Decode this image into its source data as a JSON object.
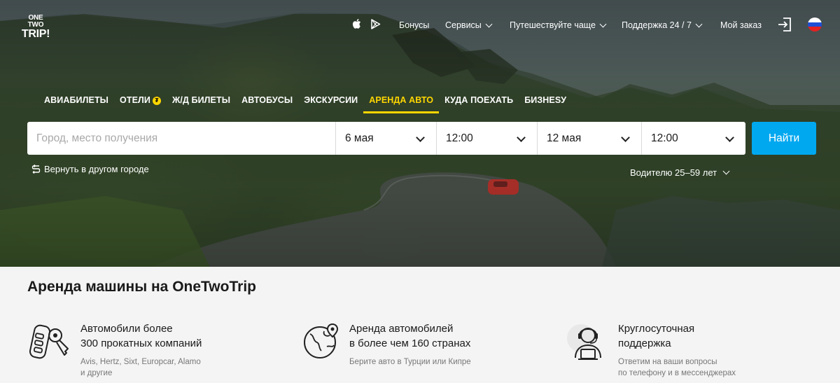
{
  "brand": {
    "logo_line1": "ONE TWO",
    "logo_line2": "TRIP!"
  },
  "topnav": {
    "apple_icon": "apple-icon",
    "play_icon": "google-play-icon",
    "bonuses": "Бонусы",
    "services": "Сервисы",
    "travel_more": "Путешествуйте чаще",
    "support": "Поддержка 24 / 7",
    "my_order": "Мой заказ",
    "login_icon": "login-icon",
    "language_icon": "russian-flag-icon"
  },
  "tabs": [
    {
      "label": "АВИАБИЛЕТЫ"
    },
    {
      "label": "ОТЕЛИ",
      "badge": "₮"
    },
    {
      "label": "Ж/Д БИЛЕТЫ"
    },
    {
      "label": "АВТОБУСЫ"
    },
    {
      "label": "ЭКСКУРСИИ"
    },
    {
      "label": "АРЕНДА АВТО",
      "active": true
    },
    {
      "label": "КУДА ПОЕХАТЬ"
    },
    {
      "label": "БИЗНЕSУ"
    }
  ],
  "search": {
    "place_placeholder": "Город, место получения",
    "pickup_date": "6 мая",
    "pickup_time": "12:00",
    "return_date": "12 мая",
    "return_time": "12:00",
    "submit_label": "Найти"
  },
  "options": {
    "return_other_city": "Вернуть в другом городе",
    "driver_age": "Водителю 25–59 лет"
  },
  "about": {
    "title": "Аренда машины на OneTwoTrip",
    "features": [
      {
        "icon": "car-keys-icon",
        "heading_1": "Автомобили более",
        "heading_2": "300 прокатных компаний",
        "sub_1": "Avis, Hertz, Sixt, Europcar, Alamo",
        "sub_2": "и другие"
      },
      {
        "icon": "globe-location-icon",
        "heading_1": "Аренда автомобилей",
        "heading_2": "в более чем 160 странах",
        "sub_1": "Берите авто в Турции или Кипре",
        "sub_2": ""
      },
      {
        "icon": "support-agent-icon",
        "heading_1": "Круглосуточная",
        "heading_2": "поддержка",
        "sub_1": "Ответим на ваши вопросы",
        "sub_2": "по телефону и в мессенджерах"
      }
    ]
  },
  "colors": {
    "accent": "#ffd600",
    "button": "#00a8f0",
    "bottom_bg": "#f4f4f4"
  }
}
